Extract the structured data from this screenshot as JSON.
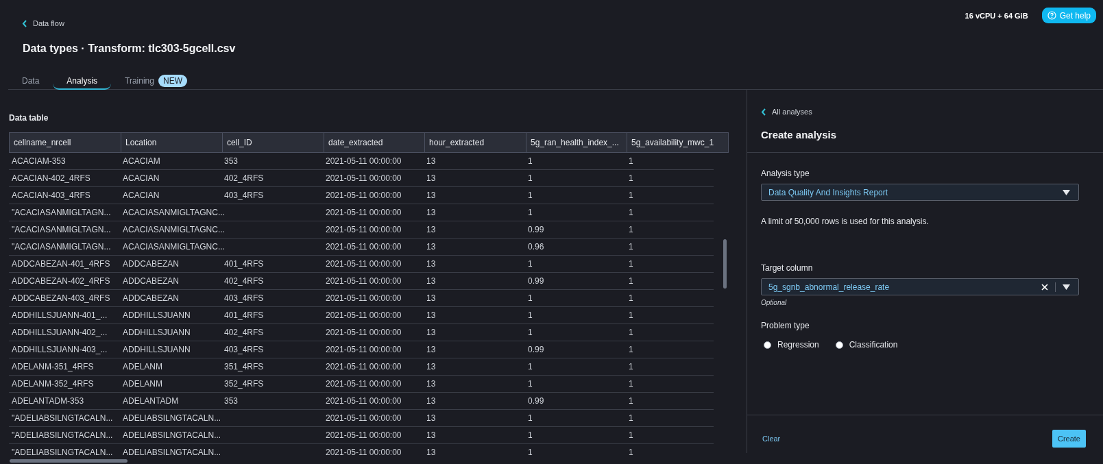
{
  "header": {
    "back_link": "Data flow",
    "title": "Data types · Transform: tlc303-5gcell.csv",
    "instance": "16 vCPU + 64 GiB",
    "help_button": "Get help"
  },
  "tabs": [
    {
      "label": "Data",
      "selected": false
    },
    {
      "label": "Analysis",
      "selected": true
    },
    {
      "label": "Training",
      "selected": false,
      "badge": "NEW"
    }
  ],
  "table": {
    "title": "Data table",
    "columns": [
      "cellname_nrcell",
      "Location",
      "cell_ID",
      "date_extracted",
      "hour_extracted",
      "5g_ran_health_index_...",
      "5g_availability_mwc_1"
    ],
    "rows": [
      [
        "ACACIAM-353",
        "ACACIAM",
        "353",
        "2021-05-11 00:00:00",
        "13",
        "1",
        "1"
      ],
      [
        "ACACIAN-402_4RFS",
        "ACACIAN",
        "402_4RFS",
        "2021-05-11 00:00:00",
        "13",
        "1",
        "1"
      ],
      [
        "ACACIAN-403_4RFS",
        "ACACIAN",
        "403_4RFS",
        "2021-05-11 00:00:00",
        "13",
        "1",
        "1"
      ],
      [
        "\"ACACIASANMIGLTAGN...",
        "ACACIASANMIGLTAGNC...",
        "",
        "2021-05-11 00:00:00",
        "13",
        "1",
        "1"
      ],
      [
        "\"ACACIASANMIGLTAGN...",
        "ACACIASANMIGLTAGNC...",
        "",
        "2021-05-11 00:00:00",
        "13",
        "0.99",
        "1"
      ],
      [
        "\"ACACIASANMIGLTAGN...",
        "ACACIASANMIGLTAGNC...",
        "",
        "2021-05-11 00:00:00",
        "13",
        "0.96",
        "1"
      ],
      [
        "ADDCABEZAN-401_4RFS",
        "ADDCABEZAN",
        "401_4RFS",
        "2021-05-11 00:00:00",
        "13",
        "1",
        "1"
      ],
      [
        "ADDCABEZAN-402_4RFS",
        "ADDCABEZAN",
        "402_4RFS",
        "2021-05-11 00:00:00",
        "13",
        "0.99",
        "1"
      ],
      [
        "ADDCABEZAN-403_4RFS",
        "ADDCABEZAN",
        "403_4RFS",
        "2021-05-11 00:00:00",
        "13",
        "1",
        "1"
      ],
      [
        "ADDHILLSJUANN-401_...",
        "ADDHILLSJUANN",
        "401_4RFS",
        "2021-05-11 00:00:00",
        "13",
        "1",
        "1"
      ],
      [
        "ADDHILLSJUANN-402_...",
        "ADDHILLSJUANN",
        "402_4RFS",
        "2021-05-11 00:00:00",
        "13",
        "1",
        "1"
      ],
      [
        "ADDHILLSJUANN-403_...",
        "ADDHILLSJUANN",
        "403_4RFS",
        "2021-05-11 00:00:00",
        "13",
        "0.99",
        "1"
      ],
      [
        "ADELANM-351_4RFS",
        "ADELANM",
        "351_4RFS",
        "2021-05-11 00:00:00",
        "13",
        "1",
        "1"
      ],
      [
        "ADELANM-352_4RFS",
        "ADELANM",
        "352_4RFS",
        "2021-05-11 00:00:00",
        "13",
        "1",
        "1"
      ],
      [
        "ADELANTADM-353",
        "ADELANTADM",
        "353",
        "2021-05-11 00:00:00",
        "13",
        "0.99",
        "1"
      ],
      [
        "\"ADELIABSILNGTACALN...",
        "ADELIABSILNGTACALN...",
        "",
        "2021-05-11 00:00:00",
        "13",
        "1",
        "1"
      ],
      [
        "\"ADELIABSILNGTACALN...",
        "ADELIABSILNGTACALN...",
        "",
        "2021-05-11 00:00:00",
        "13",
        "1",
        "1"
      ],
      [
        "\"ADELIABSILNGTACALN...",
        "ADELIABSILNGTACALN...",
        "",
        "2021-05-11 00:00:00",
        "13",
        "1",
        "1"
      ]
    ]
  },
  "panel": {
    "back_link": "All analyses",
    "title": "Create analysis",
    "analysis_type": {
      "label": "Analysis type",
      "value": "Data Quality And Insights Report"
    },
    "note": "A limit of 50,000 rows is used for this analysis.",
    "target_column": {
      "label": "Target column",
      "value": "5g_sgnb_abnormal_release_rate",
      "hint": "Optional"
    },
    "problem_type": {
      "label": "Problem type",
      "options": [
        {
          "label": "Regression",
          "selected": false
        },
        {
          "label": "Classification",
          "selected": false
        }
      ]
    },
    "clear_button": "Clear",
    "create_button": "Create"
  }
}
